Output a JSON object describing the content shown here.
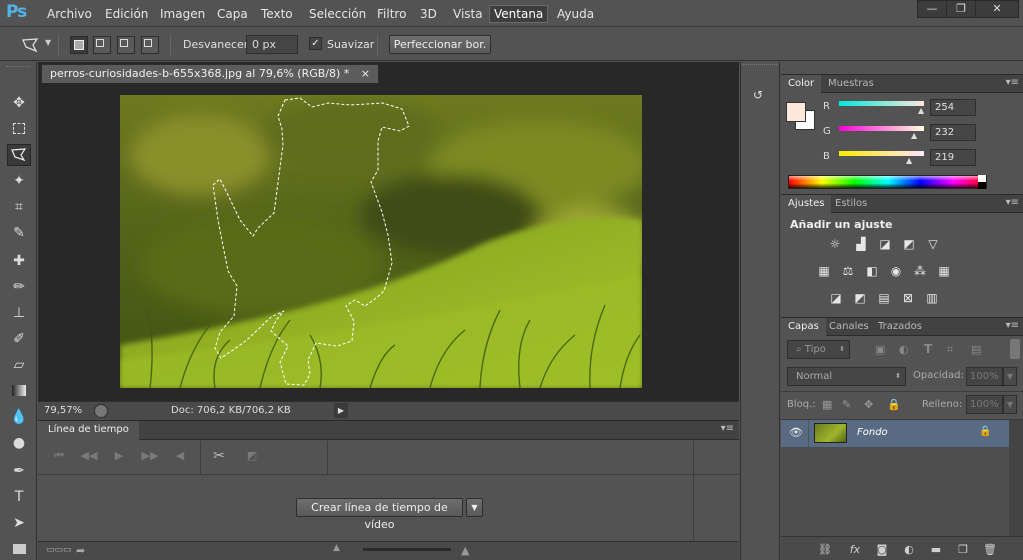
{
  "app": {
    "logo": "Ps"
  },
  "menu": [
    "Archivo",
    "Edición",
    "Imagen",
    "Capa",
    "Texto",
    "Selección",
    "Filtro",
    "3D",
    "Vista",
    "Ventana",
    "Ayuda"
  ],
  "menu_active": "Ventana",
  "window_controls": {
    "minimize": "—",
    "restore": "❐",
    "close": "✕"
  },
  "options": {
    "feather_label": "Desvanecer:",
    "feather_value": "0 px",
    "antialias_label": "Suavizar",
    "antialias_checked": true,
    "refine_button": "Perfeccionar bor."
  },
  "document": {
    "tab_title": "perros-curiosidades-b-655x368.jpg al 79,6% (RGB/8) *",
    "close": "×",
    "zoom": "79,57%",
    "doc_info": "Doc: 706,2 KB/706,2 KB"
  },
  "timeline": {
    "title": "Línea de tiempo",
    "create_button": "Crear línea de tiempo de vídeo"
  },
  "color_panel": {
    "tabs": [
      "Color",
      "Muestras"
    ],
    "channels": [
      {
        "label": "R",
        "value": "254"
      },
      {
        "label": "G",
        "value": "232"
      },
      {
        "label": "B",
        "value": "219"
      }
    ],
    "foreground": "#fee8db",
    "background": "#ffffff"
  },
  "adjustments_panel": {
    "tabs": [
      "Ajustes",
      "Estilos"
    ],
    "heading": "Añadir un ajuste"
  },
  "layers_panel": {
    "tabs": [
      "Capas",
      "Canales",
      "Trazados"
    ],
    "filter_label": "Tipo",
    "blend_mode": "Normal",
    "opacity_label": "Opacidad:",
    "opacity_value": "100%",
    "lock_label": "Bloq.:",
    "fill_label": "Relleno:",
    "fill_value": "100%",
    "layers": [
      {
        "name": "Fondo",
        "locked": true,
        "visible": true
      }
    ]
  },
  "colors": {
    "accent": "#52b3ea",
    "selected_layer": "#596b83"
  }
}
